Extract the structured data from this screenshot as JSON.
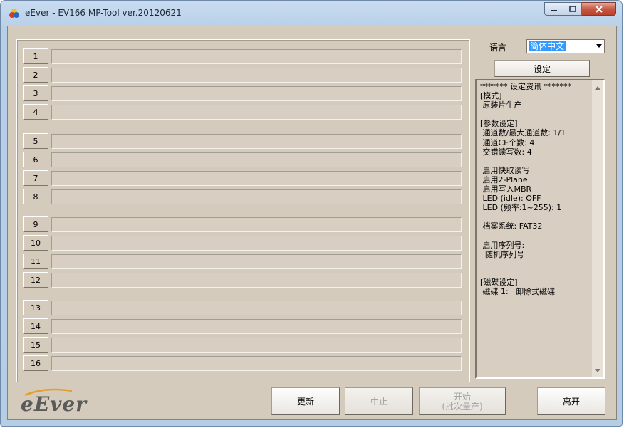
{
  "window": {
    "title": "eEver - EV166 MP-Tool ver.20120621"
  },
  "ports": [
    {
      "label": "1"
    },
    {
      "label": "2"
    },
    {
      "label": "3"
    },
    {
      "label": "4"
    },
    {
      "label": "5"
    },
    {
      "label": "6"
    },
    {
      "label": "7"
    },
    {
      "label": "8"
    },
    {
      "label": "9"
    },
    {
      "label": "10"
    },
    {
      "label": "11"
    },
    {
      "label": "12"
    },
    {
      "label": "13"
    },
    {
      "label": "14"
    },
    {
      "label": "15"
    },
    {
      "label": "16"
    }
  ],
  "language": {
    "label": "语言",
    "selected": "简体中文"
  },
  "settings_button": "设定",
  "info_text": "******* 设定资讯 *******\n[模式]\n 原装片生产\n\n[参数设定]\n 通道数/最大通道数: 1/1\n 通道CE个数: 4\n 交错读写数: 4\n\n 启用快取读写\n 启用2-Plane\n 启用写入MBR\n LED (idle): OFF\n LED (频率:1~255): 1\n\n 档案系统: FAT32\n\n 启用序列号:\n  随机序列号\n\n\n[磁碟设定]\n 磁碟 1:   卸除式磁碟",
  "logo": "eEver",
  "buttons": {
    "update": "更新",
    "stop": "中止",
    "start_line1": "开始",
    "start_line2": "(批次量产)",
    "exit": "离开"
  },
  "colors": {
    "client_bg": "#d4cbbd",
    "select_highlight": "#3399ff",
    "close_button": "#c75a44"
  }
}
